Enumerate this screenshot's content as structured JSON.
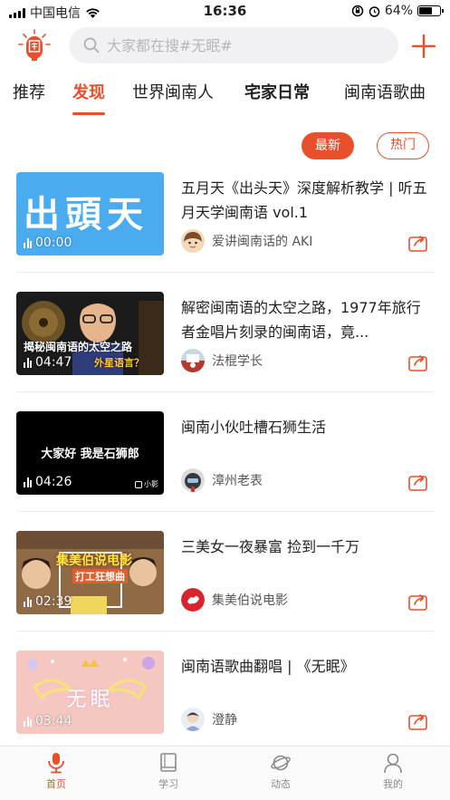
{
  "status_bar": {
    "carrier": "中国电信",
    "time": "16:36",
    "battery": "64%",
    "battery_level": 0.64
  },
  "header": {
    "search_placeholder": "大家都在搜#无眠#",
    "icons": [
      "app-logo-icon",
      "search-icon",
      "plus-icon"
    ]
  },
  "tabs": [
    {
      "label": "推荐"
    },
    {
      "label": "发现",
      "active": true
    },
    {
      "label": "世界闽南人"
    },
    {
      "label": "宅家日常"
    },
    {
      "label": "闽南语歌曲"
    }
  ],
  "sort": {
    "new_label": "最新",
    "hot_label": "热门"
  },
  "videos": [
    {
      "title": "五月天《出头天》深度解析教学 | 听五月天学闽南语 vol.1",
      "author": "爱讲闽南话的 AKI",
      "duration": "00:00",
      "thumb_text": "出頭天",
      "thumb_color": "#4aabef"
    },
    {
      "title": "解密闽南语的太空之路，1977年旅行者金唱片刻录的闽南语，竟...",
      "author": "法棍学长",
      "duration": "04:47",
      "thumb_text": "揭秘闽南语的太空之路",
      "thumb_text_2": "外星语言？",
      "thumb_color": "#1b1b1b"
    },
    {
      "title": "闽南小伙吐槽石狮生活",
      "author": "漳州老表",
      "duration": "04:26",
      "thumb_text": "大家好 我是石狮郎",
      "thumb_badge": "小影",
      "thumb_color": "#000000"
    },
    {
      "title": "三美女一夜暴富 捡到一千万",
      "author": "集美伯说电影",
      "duration": "02:39",
      "thumb_text": "集美伯说电影",
      "thumb_text_2": "打工狂想曲",
      "thumb_color": "#b58a5a"
    },
    {
      "title": "闽南语歌曲翻唱 | 《无眠》",
      "author": "澄静",
      "duration": "03:44",
      "thumb_text": "无眠",
      "thumb_color": "#f6c7c0"
    }
  ],
  "bottom_nav": [
    {
      "label": "首页",
      "icon": "microphone-icon",
      "active": true
    },
    {
      "label": "学习",
      "icon": "book-icon"
    },
    {
      "label": "动态",
      "icon": "planet-icon"
    },
    {
      "label": "我的",
      "icon": "profile-icon"
    }
  ],
  "colors": {
    "accent": "#e8502c",
    "divider": "#ececec",
    "search_bg": "#f1f1f3"
  }
}
